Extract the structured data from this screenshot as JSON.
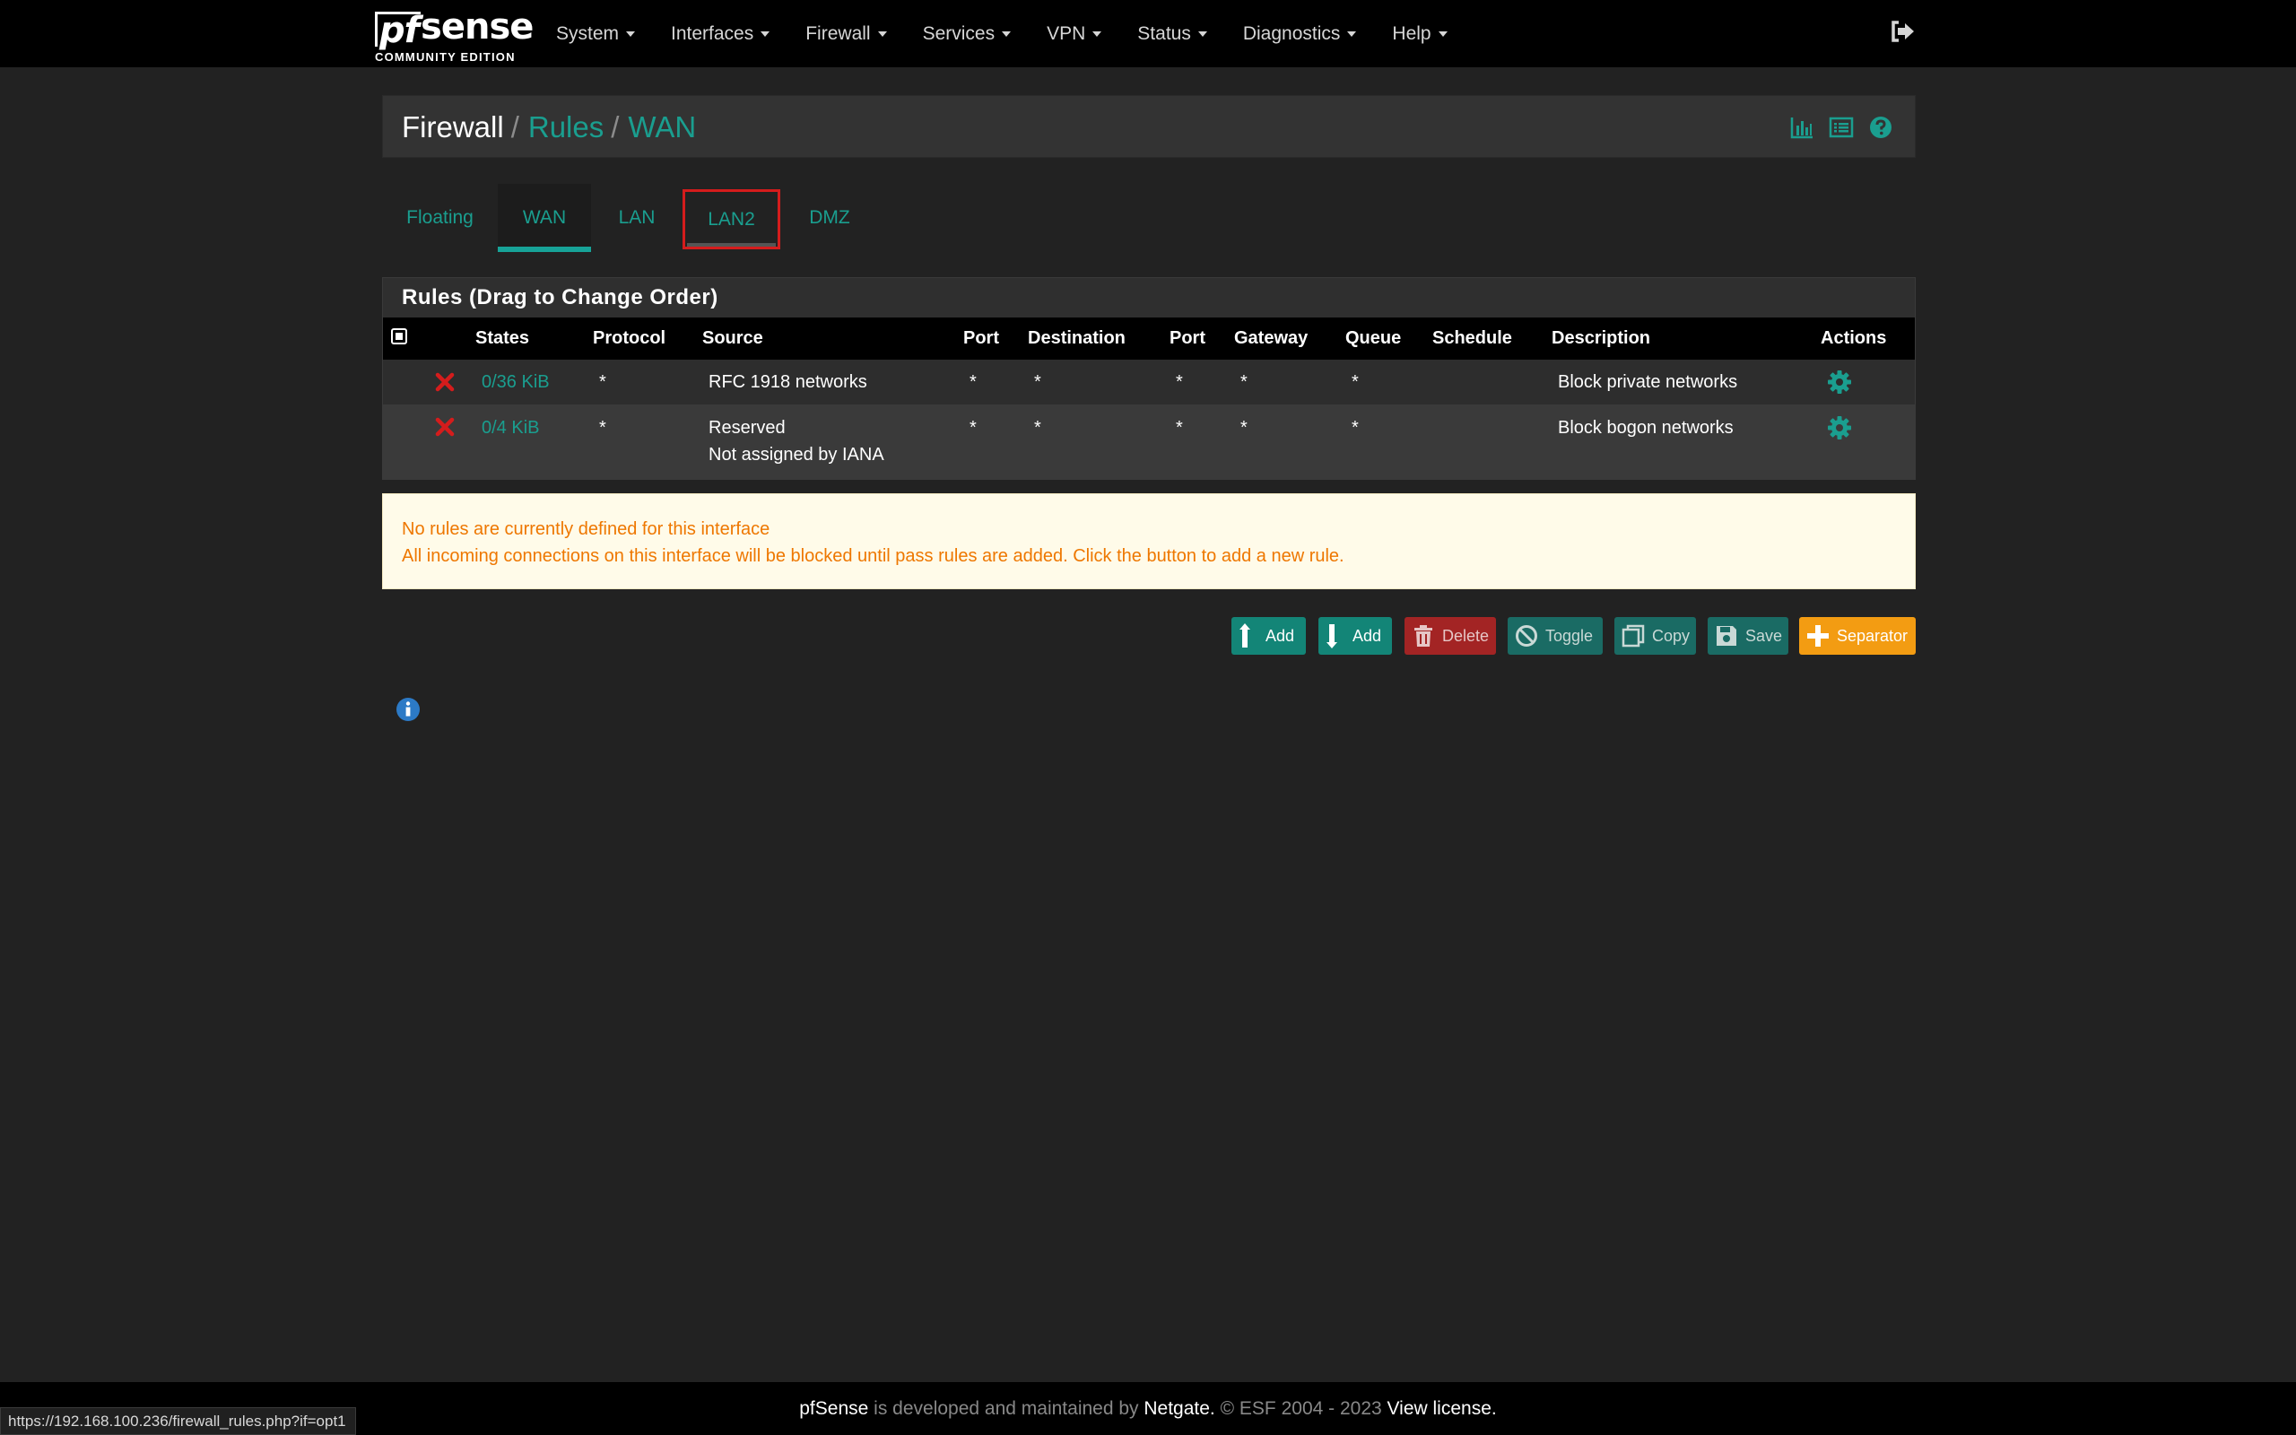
{
  "logo": {
    "main": "sense",
    "pf": "pf",
    "sub": "COMMUNITY EDITION"
  },
  "nav": {
    "items": [
      {
        "label": "System"
      },
      {
        "label": "Interfaces"
      },
      {
        "label": "Firewall"
      },
      {
        "label": "Services"
      },
      {
        "label": "VPN"
      },
      {
        "label": "Status"
      },
      {
        "label": "Diagnostics"
      },
      {
        "label": "Help"
      }
    ],
    "logout_icon": "sign-out-icon"
  },
  "breadcrumb": {
    "part1": "Firewall",
    "sep": "/",
    "part2": "Rules",
    "part3": "WAN",
    "icons": [
      "bar-chart-icon",
      "list-icon",
      "help-circle-icon"
    ]
  },
  "tabs": [
    {
      "label": "Floating",
      "active": false
    },
    {
      "label": "WAN",
      "active": true
    },
    {
      "label": "LAN",
      "active": false
    },
    {
      "label": "LAN2",
      "active": false,
      "highlighted": true
    },
    {
      "label": "DMZ",
      "active": false
    }
  ],
  "rules": {
    "heading": "Rules (Drag to Change Order)",
    "columns": [
      "States",
      "Protocol",
      "Source",
      "Port",
      "Destination",
      "Port",
      "Gateway",
      "Queue",
      "Schedule",
      "Description",
      "Actions"
    ],
    "rows": [
      {
        "action_icon": "block-x-icon",
        "states": "0/36 KiB",
        "protocol": "*",
        "source": "RFC 1918 networks",
        "source_line2": "",
        "port": "*",
        "destination": "*",
        "dest_port": "*",
        "gateway": "*",
        "queue": "*",
        "schedule": "",
        "description": "Block private networks",
        "actions_icon": "gear-icon"
      },
      {
        "action_icon": "block-x-icon",
        "states": "0/4 KiB",
        "protocol": "*",
        "source": "Reserved",
        "source_line2": "Not assigned by IANA",
        "port": "*",
        "destination": "*",
        "dest_port": "*",
        "gateway": "*",
        "queue": "*",
        "schedule": "",
        "description": "Block bogon networks",
        "actions_icon": "gear-icon"
      }
    ]
  },
  "warning": {
    "line1": "No rules are currently defined for this interface",
    "line2": "All incoming connections on this interface will be blocked until pass rules are added. Click the button to add a new rule."
  },
  "buttons": {
    "add_top": "Add",
    "add_bottom": "Add",
    "delete": "Delete",
    "toggle": "Toggle",
    "copy": "Copy",
    "save": "Save",
    "separator": "Separator"
  },
  "info_icon": "info-circle-icon",
  "footer": {
    "brand": "pfSense",
    "text1": "is developed and maintained by",
    "company": "Netgate.",
    "text2": "© ESF 2004 - 2023",
    "license": "View license."
  },
  "status_url": "https://192.168.100.236/firewall_rules.php?if=opt1",
  "colors": {
    "accent": "#1a9e8f",
    "danger": "#d51c1c",
    "warning_text": "#ee7700",
    "warning_bg": "#fffbe9",
    "separator_btn": "#f39c12"
  }
}
